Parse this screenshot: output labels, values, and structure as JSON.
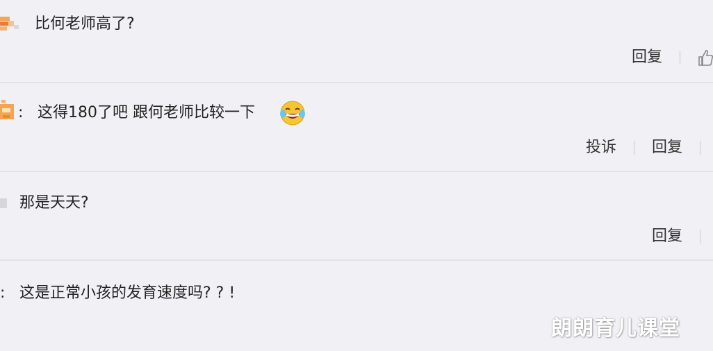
{
  "comments": [
    {
      "text": "比何老师高了?",
      "actions": [
        "回复"
      ]
    },
    {
      "colon": ":",
      "text": "这得180了吧 跟何老师比较一下",
      "emoji": "laughing-tears",
      "actions": [
        "投诉",
        "回复"
      ]
    },
    {
      "text": "那是天天?",
      "actions": [
        "回复"
      ]
    },
    {
      "colon": ":",
      "text": "这是正常小孩的发育速度吗? ? !"
    }
  ],
  "watermark": "朗朗育儿课堂",
  "colors": {
    "background": "#f1f0f4",
    "divider": "#e2e1e6",
    "text": "#222222"
  }
}
